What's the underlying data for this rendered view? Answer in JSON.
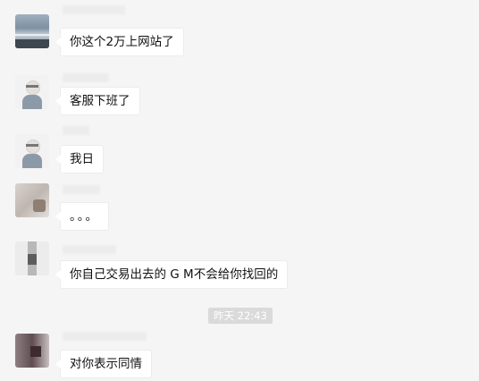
{
  "chat": {
    "messages": [
      {
        "text": "你这个2万上网站了"
      },
      {
        "text": "客服下班了"
      },
      {
        "text": "我日"
      },
      {
        "text": "。。。"
      },
      {
        "text": "你自己交易出去的 G M不会给你找回的"
      },
      {
        "text": "对你表示同情"
      }
    ],
    "timestamp": "昨天 22:43"
  }
}
